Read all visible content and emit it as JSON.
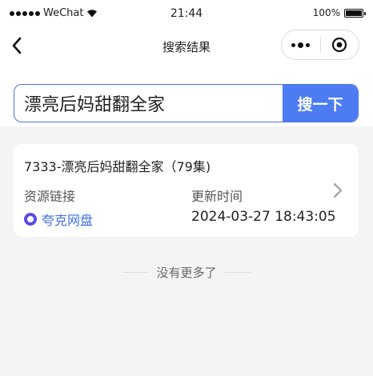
{
  "status_bar": {
    "carrier": "WeChat",
    "time": "21:44",
    "battery": "100%"
  },
  "nav": {
    "title": "搜索结果"
  },
  "search": {
    "value": "漂亮后妈甜翻全家",
    "button_label": "搜一下"
  },
  "results": [
    {
      "title": "7333-漂亮后妈甜翻全家（79集)",
      "resource_label": "资源链接",
      "resource_name": "夸克网盘",
      "update_label": "更新时间",
      "update_time": "2024-03-27 18:43:05"
    }
  ],
  "footer": {
    "no_more": "没有更多了"
  },
  "colors": {
    "accent": "#4d7cf2",
    "link": "#3d6fe8",
    "disk_icon": "#5b4de0",
    "background": "#f4f4f4"
  }
}
